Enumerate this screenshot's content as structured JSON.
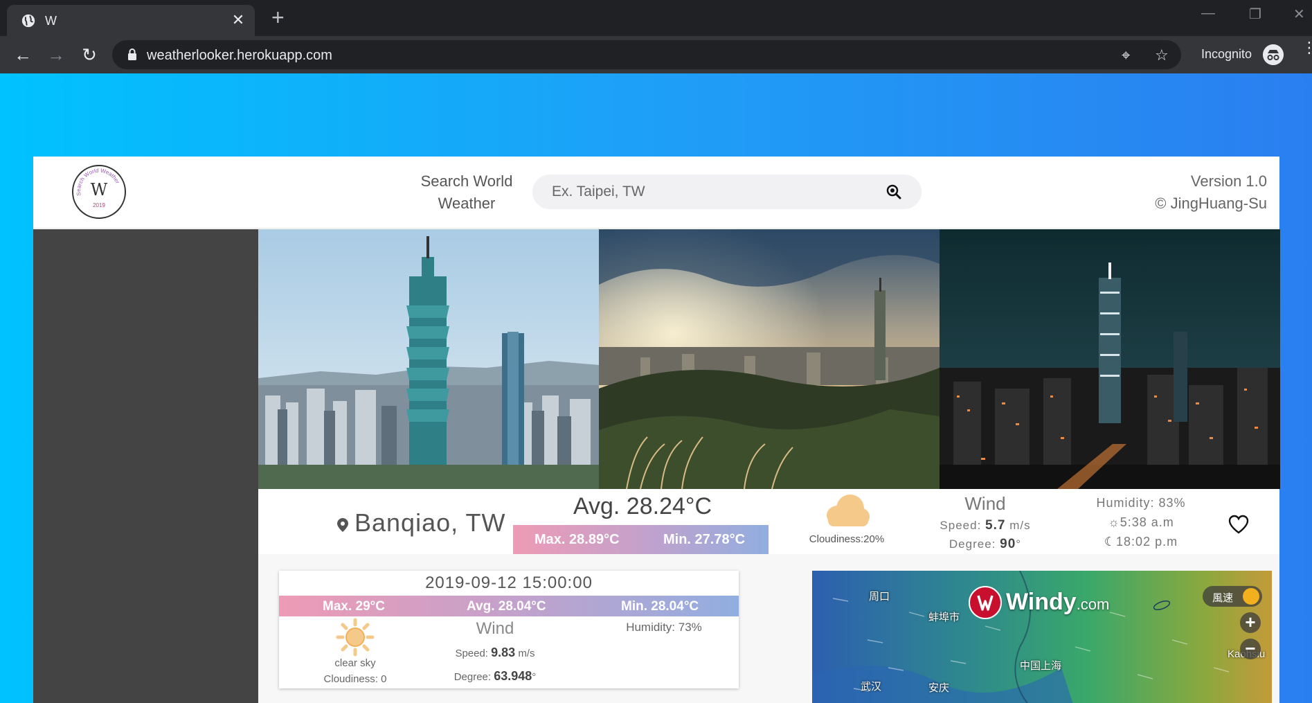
{
  "browser": {
    "tab_title": "W",
    "tab_close": "✕",
    "new_tab": "+",
    "url": "weatherlooker.herokuapp.com",
    "incognito_label": "Incognito"
  },
  "header": {
    "logo_letter": "W",
    "logo_ring_text": "Search World Weather",
    "logo_year": "2019",
    "search_label_line1": "Search World",
    "search_label_line2": "Weather",
    "search_placeholder": "Ex. Taipei, TW",
    "search_value": "",
    "version_line1": "Version 1.0",
    "version_line2": "© JingHuang-Su"
  },
  "current": {
    "city": "Banqiao, TW",
    "avg": "Avg. 28.24°C",
    "max": "Max. 28.89°C",
    "min": "Min. 27.78°C",
    "cloudiness": "Cloudiness:20%",
    "wind_title": "Wind",
    "speed_label": "Speed:",
    "speed_value": "5.7",
    "speed_unit": "m/s",
    "degree_label": "Degree:",
    "degree_value": "90",
    "degree_unit": "°",
    "humidity": "Humidity: 83%",
    "sunrise": "5:38 a.m",
    "sunset": "18:02 p.m"
  },
  "forecast": {
    "datetime": "2019-09-12 15:00:00",
    "max": "Max. 29°C",
    "avg": "Avg. 28.04°C",
    "min": "Min. 28.04°C",
    "description": "clear sky",
    "cloudiness": "Cloudiness: 0",
    "wind_title": "Wind",
    "speed_label": "Speed:",
    "speed_value": "9.83",
    "speed_unit": "m/s",
    "degree_label": "Degree:",
    "degree_value": "63.948",
    "degree_unit": "°",
    "humidity": "Humidity: 73%"
  },
  "map": {
    "brand": "Windy",
    "brand_suffix": ".com",
    "layer_label": "風速",
    "zoom_in": "+",
    "zoom_out": "−",
    "labels": [
      "周口",
      "蚌埠市",
      "中国上海",
      "武汉",
      "安庆",
      "Kaohsiu"
    ]
  },
  "colors": {
    "page_gradient_start": "#00c2fe",
    "page_gradient_end": "#2a7ff0",
    "max_pink": "#ee9bb5",
    "min_blue": "#91aee0",
    "sidebar": "#444444"
  }
}
